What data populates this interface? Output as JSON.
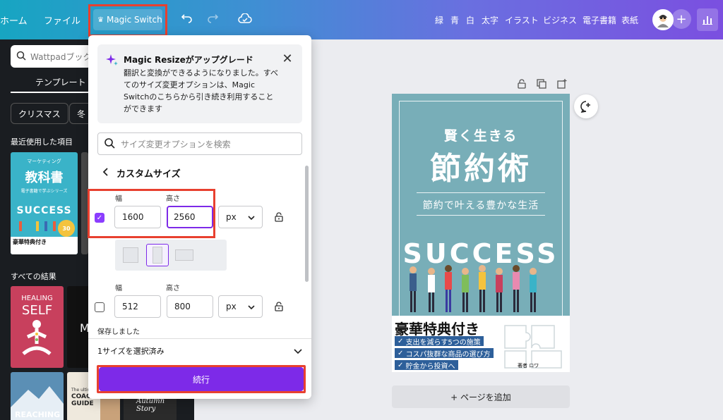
{
  "topbar": {
    "home": "ホーム",
    "file": "ファイル",
    "magic_switch": "Magic Switch",
    "right_items": [
      "緑",
      "青",
      "白",
      "太字",
      "イラスト",
      "ビジネス",
      "電子書籍",
      "表紙"
    ]
  },
  "left_panel": {
    "search_placeholder": "Wattpadブック",
    "tab_templates": "テンプレート",
    "chips": [
      "クリスマス",
      "冬"
    ],
    "recent_heading": "最近使用した項目",
    "all_results_heading": "すべての結果",
    "recent_thumb": {
      "line1": "マーケティング",
      "line2": "教科書",
      "line3": "電子書籍で学ぶシリーズ",
      "success": "SUCCESS",
      "bonus": "豪華特典付き"
    },
    "result_thumbs": [
      {
        "title": "HEALING",
        "subtitle": "SELF"
      },
      {
        "title": "MA"
      },
      {
        "title": "The ultimate",
        "subtitle": "COACHING GUIDE"
      },
      {
        "title": "Autumn Story"
      },
      {
        "title": "REACHING"
      }
    ]
  },
  "resize_panel": {
    "info_title": "Magic Resizeがアップグレード",
    "info_body": "翻訳と変換ができるようになりました。すべてのサイズ変更オプションは、Magic Switchのこちらから引き続き利用することができます",
    "search_placeholder": "サイズ変更オプションを検索",
    "custom_size_title": "カスタムサイズ",
    "width_label": "幅",
    "height_label": "高さ",
    "row1": {
      "width": "1600",
      "height": "2560",
      "unit": "px",
      "checked": true
    },
    "row2": {
      "width": "512",
      "height": "800",
      "unit": "px",
      "checked": false
    },
    "saved_text": "保存しました",
    "selected_text": "1サイズを選択済み",
    "continue_label": "続行"
  },
  "canvas": {
    "book": {
      "top_line": "賢く生きる",
      "title": "節約術",
      "subtitle": "節約で叶える豊かな生活",
      "success": "SUCCESS",
      "bonus": "豪華特典付き",
      "bullets": [
        "支出を減らす5つの施策",
        "コスパ抜群な商品の選び方",
        "貯金から投資へ"
      ],
      "author": "著者 ロワ"
    },
    "add_page": "+ ページを追加"
  },
  "colors": {
    "accent_purple": "#7d2ae8",
    "highlight_red": "#e8402f",
    "book_teal": "#78aeb8"
  }
}
